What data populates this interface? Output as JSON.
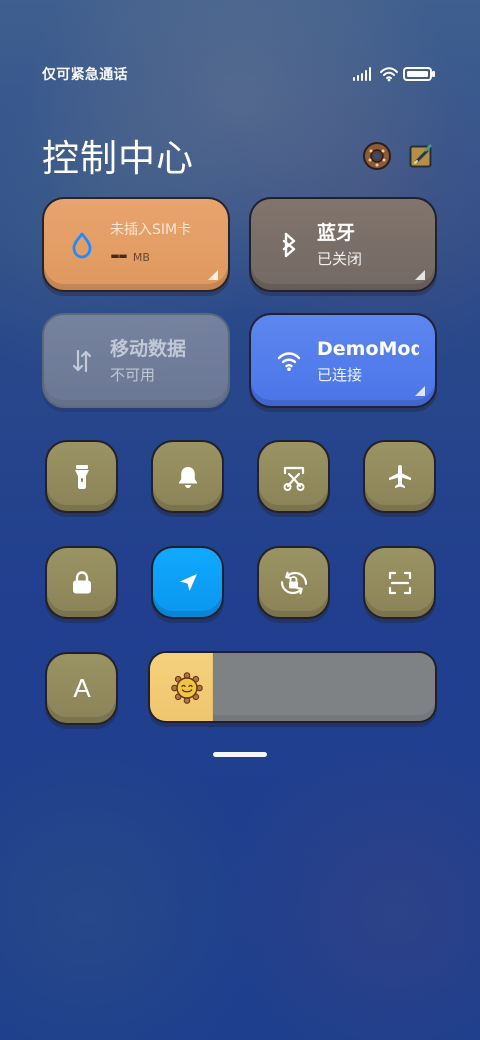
{
  "status_bar": {
    "carrier_text": "仅可紧急通话"
  },
  "header": {
    "title": "控制中心"
  },
  "cards": {
    "mobile": {
      "status": "未插入SIM卡",
      "usage": "--",
      "unit": "MB"
    },
    "bluetooth": {
      "title": "蓝牙",
      "subtitle": "已关闭"
    },
    "data": {
      "title": "移动数据",
      "subtitle": "不可用"
    },
    "wifi": {
      "title": "DemoMod",
      "subtitle": "已连接"
    }
  },
  "toggles": {
    "flashlight": {
      "icon": "flashlight-icon"
    },
    "bell": {
      "icon": "bell-icon"
    },
    "screenshot": {
      "icon": "scissors-icon"
    },
    "airplane": {
      "icon": "airplane-icon"
    },
    "lock": {
      "icon": "lock-icon"
    },
    "location": {
      "icon": "location-arrow-icon",
      "active": true
    },
    "rotation": {
      "icon": "rotation-lock-icon"
    },
    "scan": {
      "icon": "scan-icon"
    },
    "font": {
      "label": "A"
    }
  },
  "brightness": {
    "level_fraction": 0.218
  },
  "colors": {
    "mobile_card": "#E09A61",
    "bluetooth_card": "#7D716A",
    "data_card": "#8A92A6",
    "wifi_card": "#4E78EA",
    "toggle": "#948C5F",
    "toggle_active": "#0AA2FF",
    "brightness_fill": "#F2C970"
  }
}
